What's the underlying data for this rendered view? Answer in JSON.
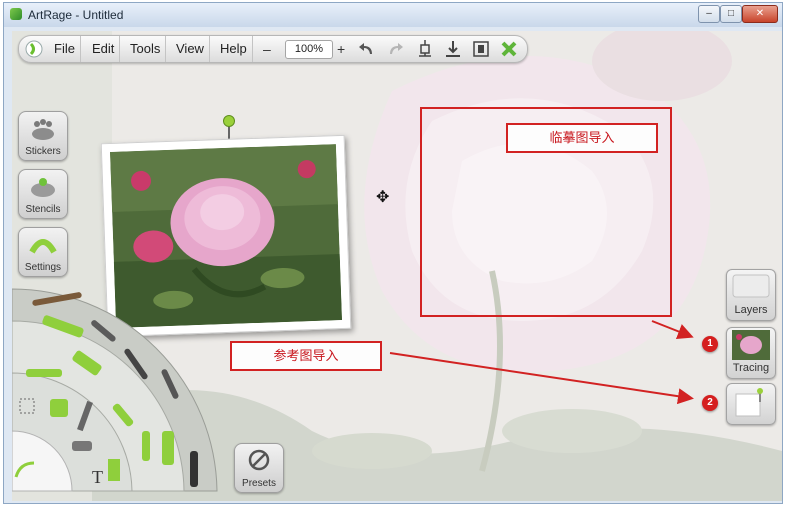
{
  "window": {
    "title": "ArtRage - Untitled",
    "controls": {
      "minimize": "–",
      "maximize": "□",
      "close": "✕"
    }
  },
  "toolbar": {
    "menus": [
      "File",
      "Edit",
      "Tools",
      "View",
      "Help"
    ],
    "zoom_out": "–",
    "zoom_value": "100%",
    "zoom_in": "+",
    "icons": [
      "undo-icon",
      "redo-icon",
      "transform-icon",
      "import-icon",
      "export-icon",
      "close-canvas-icon"
    ]
  },
  "sidebar": {
    "stickers_label": "Stickers",
    "stencils_label": "Stencils",
    "settings_label": "Settings"
  },
  "annotations": {
    "tracing_import_label": "临摹图导入",
    "reference_import_label": "参考图导入",
    "marker_1": "1",
    "marker_2": "2",
    "color": "#d22222"
  },
  "right_panel": {
    "layers_label": "Layers",
    "tracing_label": "Tracing"
  },
  "tools": {
    "text_tool_glyph": "T",
    "presets_label": "Presets"
  },
  "colors": {
    "accent_green": "#8fcf3c",
    "annotation_red": "#d22222"
  }
}
